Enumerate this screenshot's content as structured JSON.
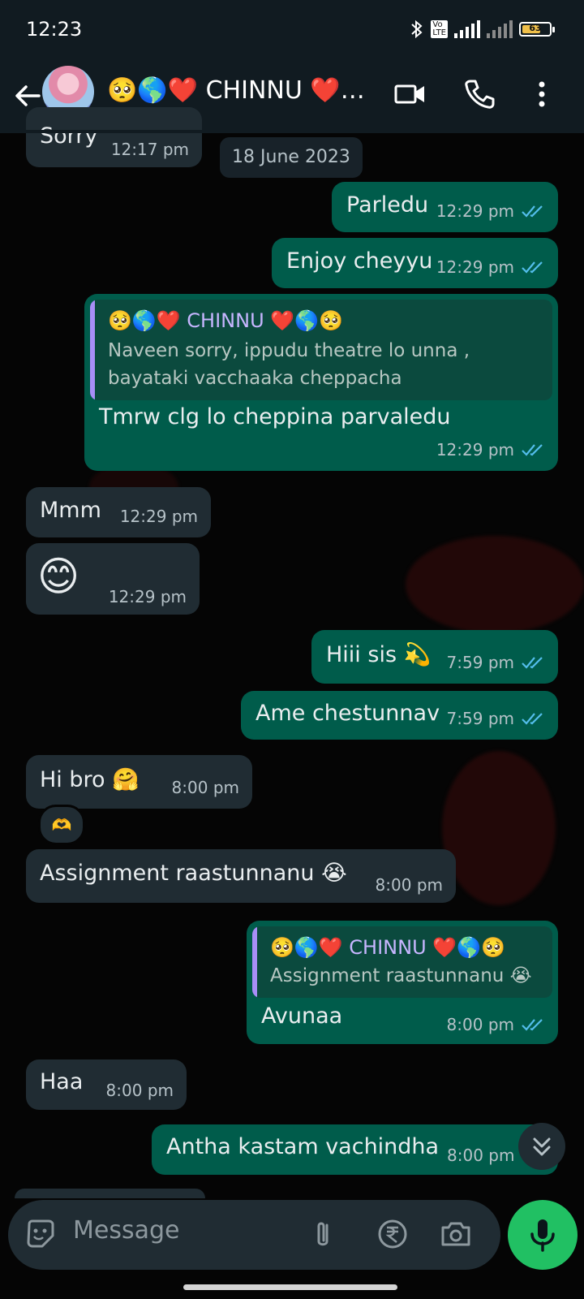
{
  "status_bar": {
    "time": "12:23",
    "battery": "63"
  },
  "header": {
    "contact_name": "🥺🌎❤️ CHINNU ❤️🌎🥺"
  },
  "date_separator": "18 June 2023",
  "messages": [
    {
      "dir": "in",
      "text": "Sorry",
      "time": "12:17 pm"
    },
    {
      "dir": "out",
      "text": "Parledu",
      "time": "12:29 pm"
    },
    {
      "dir": "out",
      "text": "Enjoy cheyyu",
      "time": "12:29 pm"
    },
    {
      "dir": "out",
      "text": "Tmrw clg lo cheppina parvaledu",
      "time": "12:29 pm",
      "quote": {
        "name": "🥺🌎❤️ CHINNU ❤️🌎🥺",
        "line1": "Naveen sorry, ippudu theatre lo unna ,",
        "line2": "bayataki vacchaaka cheppacha"
      }
    },
    {
      "dir": "in",
      "text": "Mmm",
      "time": "12:29 pm"
    },
    {
      "dir": "in",
      "text": "😊",
      "time": "12:29 pm"
    },
    {
      "dir": "out",
      "text": "Hiii sis 💫",
      "time": "7:59 pm"
    },
    {
      "dir": "out",
      "text": "Ame chestunnav",
      "time": "7:59 pm"
    },
    {
      "dir": "in",
      "text": "Hi bro 🤗",
      "time": "8:00 pm",
      "reaction": "🫶"
    },
    {
      "dir": "in",
      "text": "Assignment raastunnanu 😭",
      "time": "8:00 pm"
    },
    {
      "dir": "out",
      "text": "Avunaa",
      "time": "8:00 pm",
      "quote": {
        "name": "🥺🌎❤️ CHINNU ❤️🌎🥺",
        "line1": "Assignment raastunnanu 😭"
      }
    },
    {
      "dir": "in",
      "text": "Haa",
      "time": "8:00 pm"
    },
    {
      "dir": "out",
      "text": "Antha kastam vachindha",
      "time": "8:00 pm"
    }
  ],
  "composer": {
    "placeholder": "Message"
  },
  "colors": {
    "incoming": "#202c33",
    "outgoing": "#005c4b",
    "accent": "#21c063",
    "read_ticks": "#53bdeb"
  }
}
